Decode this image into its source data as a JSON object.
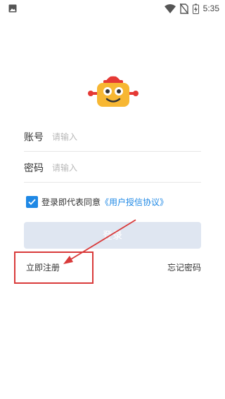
{
  "status_bar": {
    "time": "5:35"
  },
  "form": {
    "account_label": "账号",
    "account_placeholder": "请输入",
    "password_label": "密码",
    "password_placeholder": "请输入",
    "agree_text": "登录即代表同意",
    "agree_link": "《用户授信协议》",
    "agree_checked": true,
    "login_label": "登录"
  },
  "links": {
    "register": "立即注册",
    "forgot": "忘记密码"
  },
  "colors": {
    "accent": "#1e88e5",
    "button_disabled": "#dfe6f1",
    "annotation": "#d93a3a"
  },
  "icons": [
    "image-icon",
    "wifi-icon",
    "no-sim-icon",
    "battery-charging-icon",
    "robot-logo-icon",
    "checkmark-icon"
  ]
}
